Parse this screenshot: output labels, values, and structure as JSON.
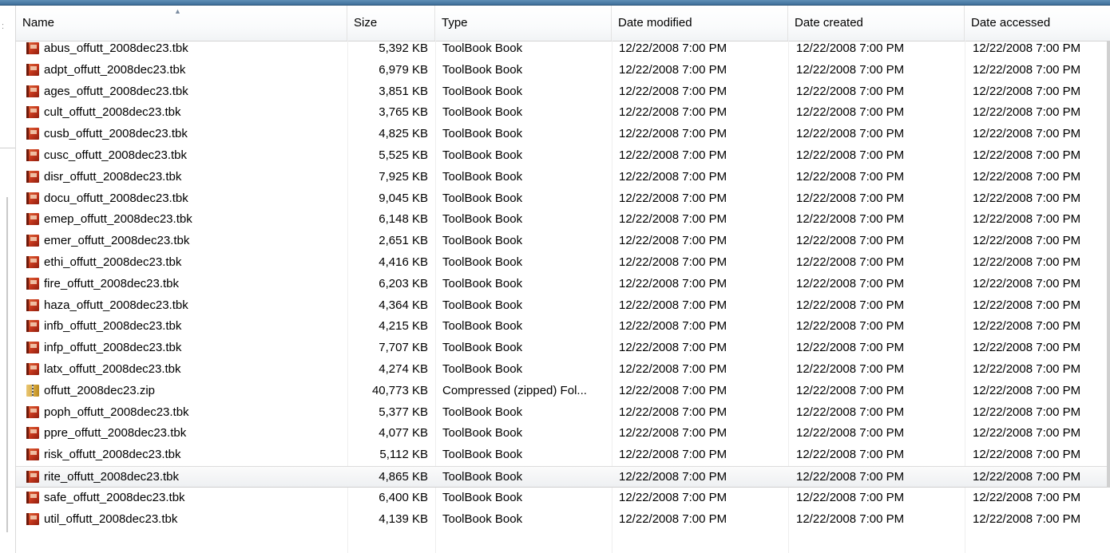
{
  "columns": {
    "name": "Name",
    "size": "Size",
    "type": "Type",
    "date_modified": "Date modified",
    "date_created": "Date created",
    "date_accessed": "Date accessed"
  },
  "icons": {
    "tbk": "toolbook-file-icon",
    "zip": "zip-folder-icon"
  },
  "colors": {
    "title_bar": "#3f6f9a",
    "hover_row": "#eef0f2"
  },
  "files": [
    {
      "name": "abus_offutt_2008dec23.tbk",
      "size": "5,392 KB",
      "type": "ToolBook Book",
      "modified": "12/22/2008 7:00 PM",
      "created": "12/22/2008 7:00 PM",
      "accessed": "12/22/2008 7:00 PM",
      "icon": "tbk"
    },
    {
      "name": "adpt_offutt_2008dec23.tbk",
      "size": "6,979 KB",
      "type": "ToolBook Book",
      "modified": "12/22/2008 7:00 PM",
      "created": "12/22/2008 7:00 PM",
      "accessed": "12/22/2008 7:00 PM",
      "icon": "tbk"
    },
    {
      "name": "ages_offutt_2008dec23.tbk",
      "size": "3,851 KB",
      "type": "ToolBook Book",
      "modified": "12/22/2008 7:00 PM",
      "created": "12/22/2008 7:00 PM",
      "accessed": "12/22/2008 7:00 PM",
      "icon": "tbk"
    },
    {
      "name": "cult_offutt_2008dec23.tbk",
      "size": "3,765 KB",
      "type": "ToolBook Book",
      "modified": "12/22/2008 7:00 PM",
      "created": "12/22/2008 7:00 PM",
      "accessed": "12/22/2008 7:00 PM",
      "icon": "tbk"
    },
    {
      "name": "cusb_offutt_2008dec23.tbk",
      "size": "4,825 KB",
      "type": "ToolBook Book",
      "modified": "12/22/2008 7:00 PM",
      "created": "12/22/2008 7:00 PM",
      "accessed": "12/22/2008 7:00 PM",
      "icon": "tbk"
    },
    {
      "name": "cusc_offutt_2008dec23.tbk",
      "size": "5,525 KB",
      "type": "ToolBook Book",
      "modified": "12/22/2008 7:00 PM",
      "created": "12/22/2008 7:00 PM",
      "accessed": "12/22/2008 7:00 PM",
      "icon": "tbk"
    },
    {
      "name": "disr_offutt_2008dec23.tbk",
      "size": "7,925 KB",
      "type": "ToolBook Book",
      "modified": "12/22/2008 7:00 PM",
      "created": "12/22/2008 7:00 PM",
      "accessed": "12/22/2008 7:00 PM",
      "icon": "tbk"
    },
    {
      "name": "docu_offutt_2008dec23.tbk",
      "size": "9,045 KB",
      "type": "ToolBook Book",
      "modified": "12/22/2008 7:00 PM",
      "created": "12/22/2008 7:00 PM",
      "accessed": "12/22/2008 7:00 PM",
      "icon": "tbk"
    },
    {
      "name": "emep_offutt_2008dec23.tbk",
      "size": "6,148 KB",
      "type": "ToolBook Book",
      "modified": "12/22/2008 7:00 PM",
      "created": "12/22/2008 7:00 PM",
      "accessed": "12/22/2008 7:00 PM",
      "icon": "tbk"
    },
    {
      "name": "emer_offutt_2008dec23.tbk",
      "size": "2,651 KB",
      "type": "ToolBook Book",
      "modified": "12/22/2008 7:00 PM",
      "created": "12/22/2008 7:00 PM",
      "accessed": "12/22/2008 7:00 PM",
      "icon": "tbk"
    },
    {
      "name": "ethi_offutt_2008dec23.tbk",
      "size": "4,416 KB",
      "type": "ToolBook Book",
      "modified": "12/22/2008 7:00 PM",
      "created": "12/22/2008 7:00 PM",
      "accessed": "12/22/2008 7:00 PM",
      "icon": "tbk"
    },
    {
      "name": "fire_offutt_2008dec23.tbk",
      "size": "6,203 KB",
      "type": "ToolBook Book",
      "modified": "12/22/2008 7:00 PM",
      "created": "12/22/2008 7:00 PM",
      "accessed": "12/22/2008 7:00 PM",
      "icon": "tbk"
    },
    {
      "name": "haza_offutt_2008dec23.tbk",
      "size": "4,364 KB",
      "type": "ToolBook Book",
      "modified": "12/22/2008 7:00 PM",
      "created": "12/22/2008 7:00 PM",
      "accessed": "12/22/2008 7:00 PM",
      "icon": "tbk"
    },
    {
      "name": "infb_offutt_2008dec23.tbk",
      "size": "4,215 KB",
      "type": "ToolBook Book",
      "modified": "12/22/2008 7:00 PM",
      "created": "12/22/2008 7:00 PM",
      "accessed": "12/22/2008 7:00 PM",
      "icon": "tbk"
    },
    {
      "name": "infp_offutt_2008dec23.tbk",
      "size": "7,707 KB",
      "type": "ToolBook Book",
      "modified": "12/22/2008 7:00 PM",
      "created": "12/22/2008 7:00 PM",
      "accessed": "12/22/2008 7:00 PM",
      "icon": "tbk"
    },
    {
      "name": "latx_offutt_2008dec23.tbk",
      "size": "4,274 KB",
      "type": "ToolBook Book",
      "modified": "12/22/2008 7:00 PM",
      "created": "12/22/2008 7:00 PM",
      "accessed": "12/22/2008 7:00 PM",
      "icon": "tbk"
    },
    {
      "name": "offutt_2008dec23.zip",
      "size": "40,773 KB",
      "type": "Compressed (zipped) Fol...",
      "modified": "12/22/2008 7:00 PM",
      "created": "12/22/2008 7:00 PM",
      "accessed": "12/22/2008 7:00 PM",
      "icon": "zip"
    },
    {
      "name": "poph_offutt_2008dec23.tbk",
      "size": "5,377 KB",
      "type": "ToolBook Book",
      "modified": "12/22/2008 7:00 PM",
      "created": "12/22/2008 7:00 PM",
      "accessed": "12/22/2008 7:00 PM",
      "icon": "tbk"
    },
    {
      "name": "ppre_offutt_2008dec23.tbk",
      "size": "4,077 KB",
      "type": "ToolBook Book",
      "modified": "12/22/2008 7:00 PM",
      "created": "12/22/2008 7:00 PM",
      "accessed": "12/22/2008 7:00 PM",
      "icon": "tbk"
    },
    {
      "name": "risk_offutt_2008dec23.tbk",
      "size": "5,112 KB",
      "type": "ToolBook Book",
      "modified": "12/22/2008 7:00 PM",
      "created": "12/22/2008 7:00 PM",
      "accessed": "12/22/2008 7:00 PM",
      "icon": "tbk"
    },
    {
      "name": "rite_offutt_2008dec23.tbk",
      "size": "4,865 KB",
      "type": "ToolBook Book",
      "modified": "12/22/2008 7:00 PM",
      "created": "12/22/2008 7:00 PM",
      "accessed": "12/22/2008 7:00 PM",
      "icon": "tbk",
      "hover": true
    },
    {
      "name": "safe_offutt_2008dec23.tbk",
      "size": "6,400 KB",
      "type": "ToolBook Book",
      "modified": "12/22/2008 7:00 PM",
      "created": "12/22/2008 7:00 PM",
      "accessed": "12/22/2008 7:00 PM",
      "icon": "tbk"
    },
    {
      "name": "util_offutt_2008dec23.tbk",
      "size": "4,139 KB",
      "type": "ToolBook Book",
      "modified": "12/22/2008 7:00 PM",
      "created": "12/22/2008 7:00 PM",
      "accessed": "12/22/2008 7:00 PM",
      "icon": "tbk"
    }
  ]
}
